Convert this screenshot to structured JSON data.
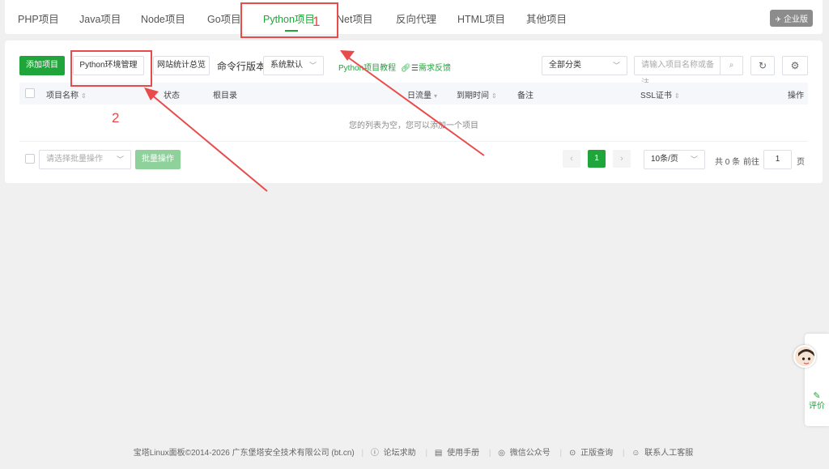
{
  "tabs": [
    {
      "label": "PHP项目"
    },
    {
      "label": "Java项目"
    },
    {
      "label": "Node项目"
    },
    {
      "label": "Go项目"
    },
    {
      "label": "Python项目"
    },
    {
      "label": "Net项目"
    },
    {
      "label": "反向代理"
    },
    {
      "label": "HTML项目"
    },
    {
      "label": "其他项目"
    }
  ],
  "active_tab": "Python项目",
  "badge": {
    "label": "企业版",
    "icon": "plane-icon"
  },
  "toolbar": {
    "add_label": "添加项目",
    "python_env_label": "Python环境管理",
    "site_stats_label": "网站统计总览",
    "cmd_version_label": "命令行版本",
    "cmd_version_value": "系统默认",
    "tutorial_label": "Python项目教程",
    "feedback_label": "需求反馈",
    "category_value": "全部分类",
    "search_placeholder": "请输入项目名称或备注"
  },
  "table": {
    "columns": {
      "name": "项目名称",
      "status": "状态",
      "root": "根目录",
      "traffic": "日流量",
      "expire": "到期时间",
      "remark": "备注",
      "ssl": "SSL证书",
      "action": "操作"
    },
    "empty_text": "您的列表为空，您可以添加一个项目"
  },
  "batch": {
    "select_placeholder": "请选择批量操作",
    "button_label": "批量操作"
  },
  "pagination": {
    "current_page": "1",
    "page_size": "10条/页",
    "total": "共 0 条",
    "goto_label": "前往",
    "goto_value": "1",
    "page_unit": "页"
  },
  "footer": {
    "copyright": "宝塔Linux面板©2014-2026 广东堡塔安全技术有限公司 (bt.cn)",
    "forum": "论坛求助",
    "manual": "使用手册",
    "wechat": "微信公众号",
    "verify": "正版查询",
    "support": "联系人工客服"
  },
  "side_widget": {
    "feedback_label": "评价"
  },
  "annotations": {
    "num1": "1",
    "num2": "2",
    "color": "#e94b4b"
  },
  "colors": {
    "accent": "#20a53a"
  }
}
